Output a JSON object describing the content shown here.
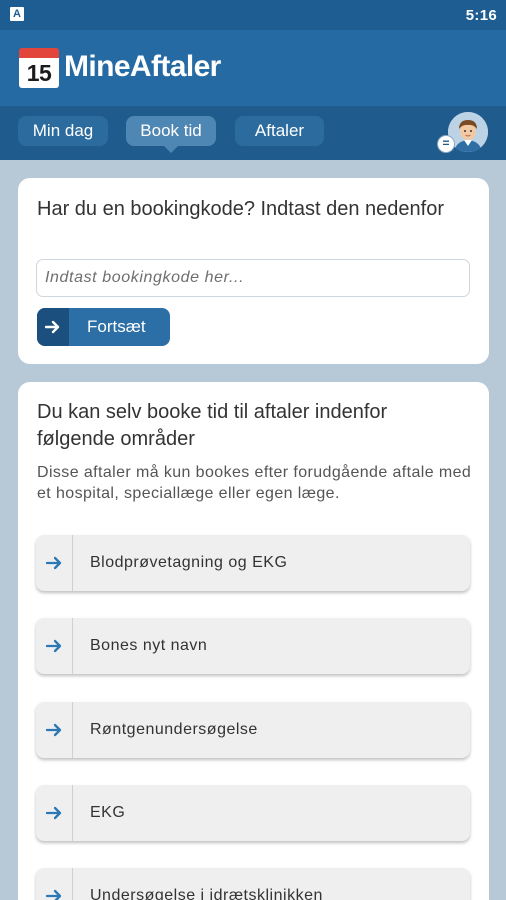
{
  "status_bar": {
    "left_icon": "A",
    "time": "5:16"
  },
  "app": {
    "calendar_day": "15",
    "title": "MineAftaler"
  },
  "tabs": [
    {
      "label": "Min dag",
      "active": false
    },
    {
      "label": "Book tid",
      "active": true
    },
    {
      "label": "Aftaler",
      "active": false
    }
  ],
  "header_icons": {
    "avatar": "user-avatar",
    "menu_badge": "="
  },
  "booking": {
    "heading": "Har du en bookingkode? Indtast den nedenfor",
    "input_placeholder": "Indtast bookingkode her...",
    "input_value": "",
    "button_label": "Fortsæt"
  },
  "areas": {
    "heading": "Du kan selv booke tid til aftaler indenfor følgende områder",
    "description": "Disse aftaler må kun bookes efter forudgående aftale med et hospital, speciallæge eller egen læge.",
    "items": [
      "Blodprøvetagning og EKG",
      "Bones nyt navn",
      "Røntgenundersøgelse",
      "EKG",
      "Undersøgelse i idrætsklinikken"
    ]
  },
  "colors": {
    "brand": "#266aa3",
    "tab_bar": "#1f5b8c",
    "arrow": "#2b78b4",
    "accent_red": "#e2453c"
  }
}
